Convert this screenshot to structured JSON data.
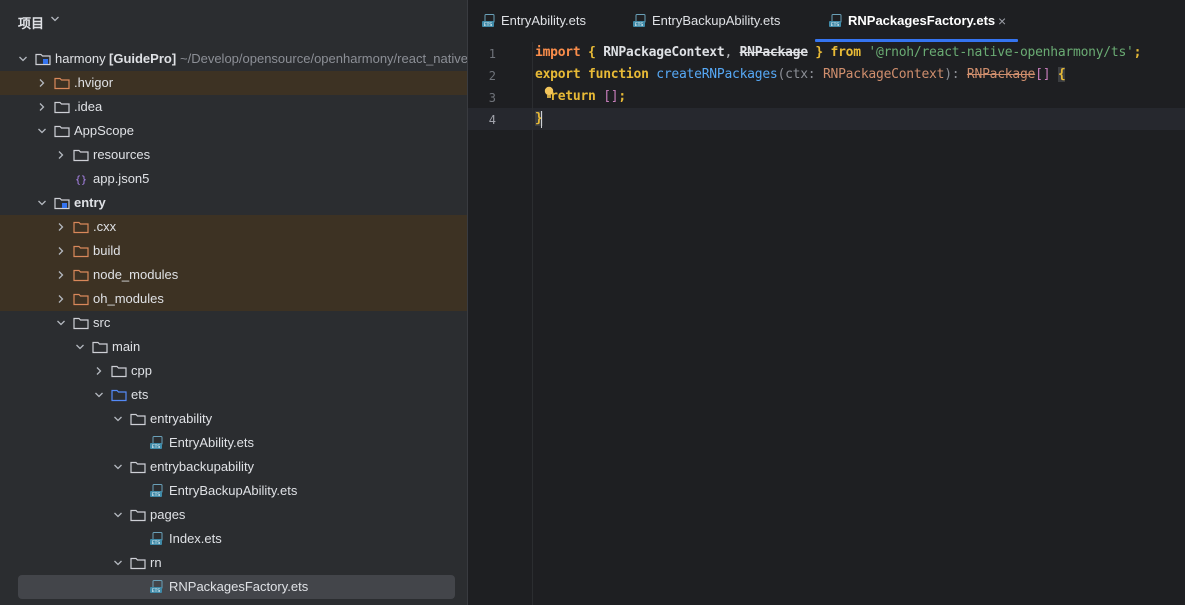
{
  "project_panel": {
    "title": "项目",
    "tree": [
      {
        "label": "harmony",
        "bold_part": "[GuidePro]",
        "suffix": "~/Develop/opensource/openharmony/react_native",
        "level": 0,
        "expanded": true,
        "icon": "module-folder-icon"
      },
      {
        "label": ".hvigor",
        "level": 1,
        "expanded": false,
        "icon": "excluded-folder-icon",
        "excluded": true
      },
      {
        "label": ".idea",
        "level": 1,
        "expanded": false,
        "icon": "folder-icon"
      },
      {
        "label": "AppScope",
        "level": 1,
        "expanded": true,
        "icon": "folder-icon"
      },
      {
        "label": "resources",
        "level": 2,
        "expanded": false,
        "icon": "folder-icon"
      },
      {
        "label": "app.json5",
        "level": 2,
        "icon": "json-file-icon"
      },
      {
        "label": "entry",
        "level": 1,
        "expanded": true,
        "icon": "module-folder-icon",
        "bold": true
      },
      {
        "label": ".cxx",
        "level": 2,
        "expanded": false,
        "icon": "excluded-folder-icon",
        "excluded": true
      },
      {
        "label": "build",
        "level": 2,
        "expanded": false,
        "icon": "excluded-folder-icon",
        "excluded": true
      },
      {
        "label": "node_modules",
        "level": 2,
        "expanded": false,
        "icon": "excluded-folder-icon",
        "excluded": true
      },
      {
        "label": "oh_modules",
        "level": 2,
        "expanded": false,
        "icon": "excluded-folder-icon",
        "excluded": true
      },
      {
        "label": "src",
        "level": 2,
        "expanded": true,
        "icon": "folder-icon"
      },
      {
        "label": "main",
        "level": 3,
        "expanded": true,
        "icon": "folder-icon"
      },
      {
        "label": "cpp",
        "level": 4,
        "expanded": false,
        "icon": "folder-icon"
      },
      {
        "label": "ets",
        "level": 4,
        "expanded": true,
        "icon": "source-folder-icon"
      },
      {
        "label": "entryability",
        "level": 5,
        "expanded": true,
        "icon": "folder-icon"
      },
      {
        "label": "EntryAbility.ets",
        "level": 6,
        "icon": "ets-file-icon"
      },
      {
        "label": "entrybackupability",
        "level": 5,
        "expanded": true,
        "icon": "folder-icon"
      },
      {
        "label": "EntryBackupAbility.ets",
        "level": 6,
        "icon": "ets-file-icon"
      },
      {
        "label": "pages",
        "level": 5,
        "expanded": true,
        "icon": "folder-icon"
      },
      {
        "label": "Index.ets",
        "level": 6,
        "icon": "ets-file-icon"
      },
      {
        "label": "rn",
        "level": 5,
        "expanded": true,
        "icon": "folder-icon"
      },
      {
        "label": "RNPackagesFactory.ets",
        "level": 6,
        "icon": "ets-file-icon",
        "selected": true
      }
    ]
  },
  "editor": {
    "tabs": [
      {
        "label": "EntryAbility.ets",
        "active": false,
        "icon": "ets-file-icon"
      },
      {
        "label": "EntryBackupAbility.ets",
        "active": false,
        "icon": "ets-file-icon"
      },
      {
        "label": "RNPackagesFactory.ets",
        "active": true,
        "icon": "ets-file-icon",
        "close": "×"
      }
    ],
    "line_numbers": [
      "1",
      "2",
      "3",
      "4"
    ],
    "current_line": 4,
    "code": {
      "line1": {
        "import": "import",
        "lbrace": " { ",
        "ctx_name": "RNPackageContext",
        "comma": ", ",
        "pkg_name": "RNPackage",
        "rbrace": " } ",
        "from": "from",
        "space": " ",
        "module": "'@rnoh/react-native-openharmony/ts'",
        "semi": ";"
      },
      "line2": {
        "export": "export",
        "function": " function ",
        "fn_name": "createRNPackages",
        "lparen": "(",
        "param": "ctx",
        "colon": ": ",
        "param_type": "RNPackageContext",
        "rparen": "): ",
        "ret_type": "RNPackage",
        "arr": "[]",
        "space": " ",
        "lcurly": "{"
      },
      "line3": {
        "indent": "  ",
        "return": "return",
        "space": " ",
        "value": "[]",
        "semi": ";"
      },
      "line4": {
        "rcurly": "}"
      }
    },
    "colors": {
      "keyword": "#cf8e6d",
      "string": "#6aab73",
      "function": "#56a8f5",
      "accent": "#3574f0",
      "excluded_bg": "#3d3223"
    }
  }
}
